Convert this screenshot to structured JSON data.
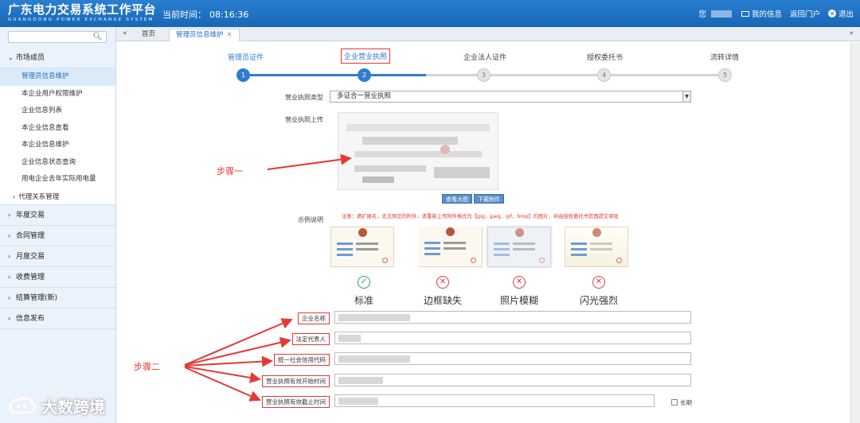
{
  "header": {
    "title_cn": "广东电力交易系统工作平台",
    "title_en": "GUANGDONG POWER EXCHANGE SYSTEM",
    "time_label": "当前时间：",
    "time_value": "08:16:36",
    "user_prefix": "您",
    "my_info": "我的信息",
    "back_portal": "返回门户",
    "logout": "退出"
  },
  "sidebar": {
    "search_placeholder": "",
    "groups": [
      {
        "label": "市场成员",
        "expanded": true
      },
      {
        "label": "年度交易"
      },
      {
        "label": "合同管理"
      },
      {
        "label": "月度交易"
      },
      {
        "label": "收费管理"
      },
      {
        "label": "结算管理(新)"
      },
      {
        "label": "信息发布"
      }
    ],
    "items": [
      {
        "label": "管理员信息维护",
        "active": true
      },
      {
        "label": "本企业用户权限维护"
      },
      {
        "label": "企业信息列表"
      },
      {
        "label": "本企业信息查看"
      },
      {
        "label": "本企业信息维护"
      },
      {
        "label": "企业信息状态查询"
      },
      {
        "label": "用电企业去年实际用电量"
      }
    ],
    "subgroup": "代理关系管理"
  },
  "tabs": {
    "home": "首页",
    "current": "管理员信息维护",
    "close": "×"
  },
  "steps": [
    {
      "label": "管理员证件",
      "num": "1",
      "status": "done"
    },
    {
      "label": "企业营业执照",
      "num": "2",
      "status": "current"
    },
    {
      "label": "企业法人证件",
      "num": "3",
      "status": "todo"
    },
    {
      "label": "授权委托书",
      "num": "4",
      "status": "todo"
    },
    {
      "label": "流转详情",
      "num": "5",
      "status": "todo"
    }
  ],
  "form": {
    "license_type_label": "营业执照类型",
    "license_type_value": "多证合一营业执照",
    "upload_label": "营业执照上传",
    "view_large": "查看大图",
    "download": "下载附件",
    "example_label": "示例说明",
    "notice": "注意：请扩展名，无法预览的附件，请重新上传附件格式为【jpg、jpeg、gif、bmp】的图片，并由授权委托书页面提交审批",
    "examples": [
      {
        "caption": "标准",
        "ok": true
      },
      {
        "caption": "边框缺失",
        "ok": false
      },
      {
        "caption": "照片模糊",
        "ok": false
      },
      {
        "caption": "闪光强烈",
        "ok": false
      }
    ],
    "fields": [
      {
        "label": "企业名称"
      },
      {
        "label": "法定代表人"
      },
      {
        "label": "统一社会信用代码"
      },
      {
        "label": "营业执照有效开始时间"
      },
      {
        "label": "营业执照有效截止时间"
      }
    ],
    "long_term": "长期"
  },
  "annotations": {
    "step1": "步骤一",
    "step2": "步骤二"
  },
  "watermark": "大数跨境",
  "colors": {
    "header": "#1f72c6",
    "accent": "#2d7dd2",
    "annotation": "#e53935"
  }
}
